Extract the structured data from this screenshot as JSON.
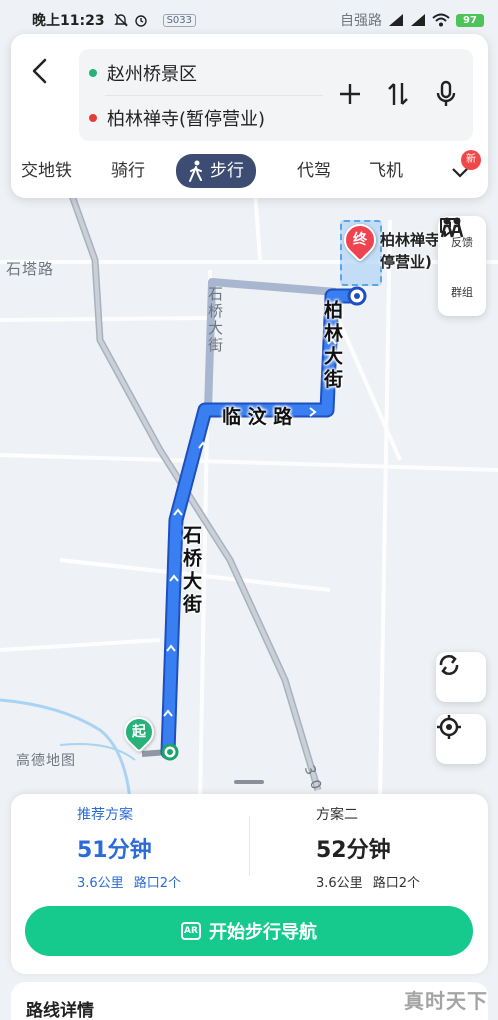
{
  "status_bar": {
    "time": "晚上11:23",
    "battery": "97",
    "map_road_behind": "S033",
    "map_road_top_right": "自强路"
  },
  "route": {
    "origin": "赵州桥景区",
    "destination": "柏林禅寺(暂停营业)",
    "origin_dot_color": "#26b27a",
    "destination_dot_color": "#e53d3d"
  },
  "modes": {
    "items": [
      {
        "label": "交地铁"
      },
      {
        "label": "骑行"
      },
      {
        "label": "步行",
        "active": true
      },
      {
        "label": "代驾"
      },
      {
        "label": "飞机"
      }
    ],
    "badge": "新"
  },
  "map": {
    "labels": {
      "shita_road": "石塔路",
      "shiqiao_street_gray": "石桥大街",
      "gaode_logo": "高德地图",
      "road_number": "3 0"
    },
    "route_labels": {
      "linwen_road": "临 汶 路",
      "bailin_street": "柏林大街",
      "shiqiao_street": "石桥大街"
    },
    "destination_pin": "终",
    "destination_name": "柏林禅寺停营业)",
    "start_pin": "起",
    "route_color": "#3477f0"
  },
  "side_tools": {
    "feedback": "反馈",
    "group": "群组"
  },
  "plans": [
    {
      "tag": "推荐方案",
      "duration": "51分钟",
      "distance": "3.6公里",
      "crossings": "路口2个"
    },
    {
      "tag": "方案二",
      "duration": "52分钟",
      "distance": "3.6公里",
      "crossings": "路口2个"
    }
  ],
  "start_nav": {
    "label": "开始步行导航",
    "ar": "AR"
  },
  "details": {
    "title": "路线详情"
  },
  "watermark": "真时天下"
}
